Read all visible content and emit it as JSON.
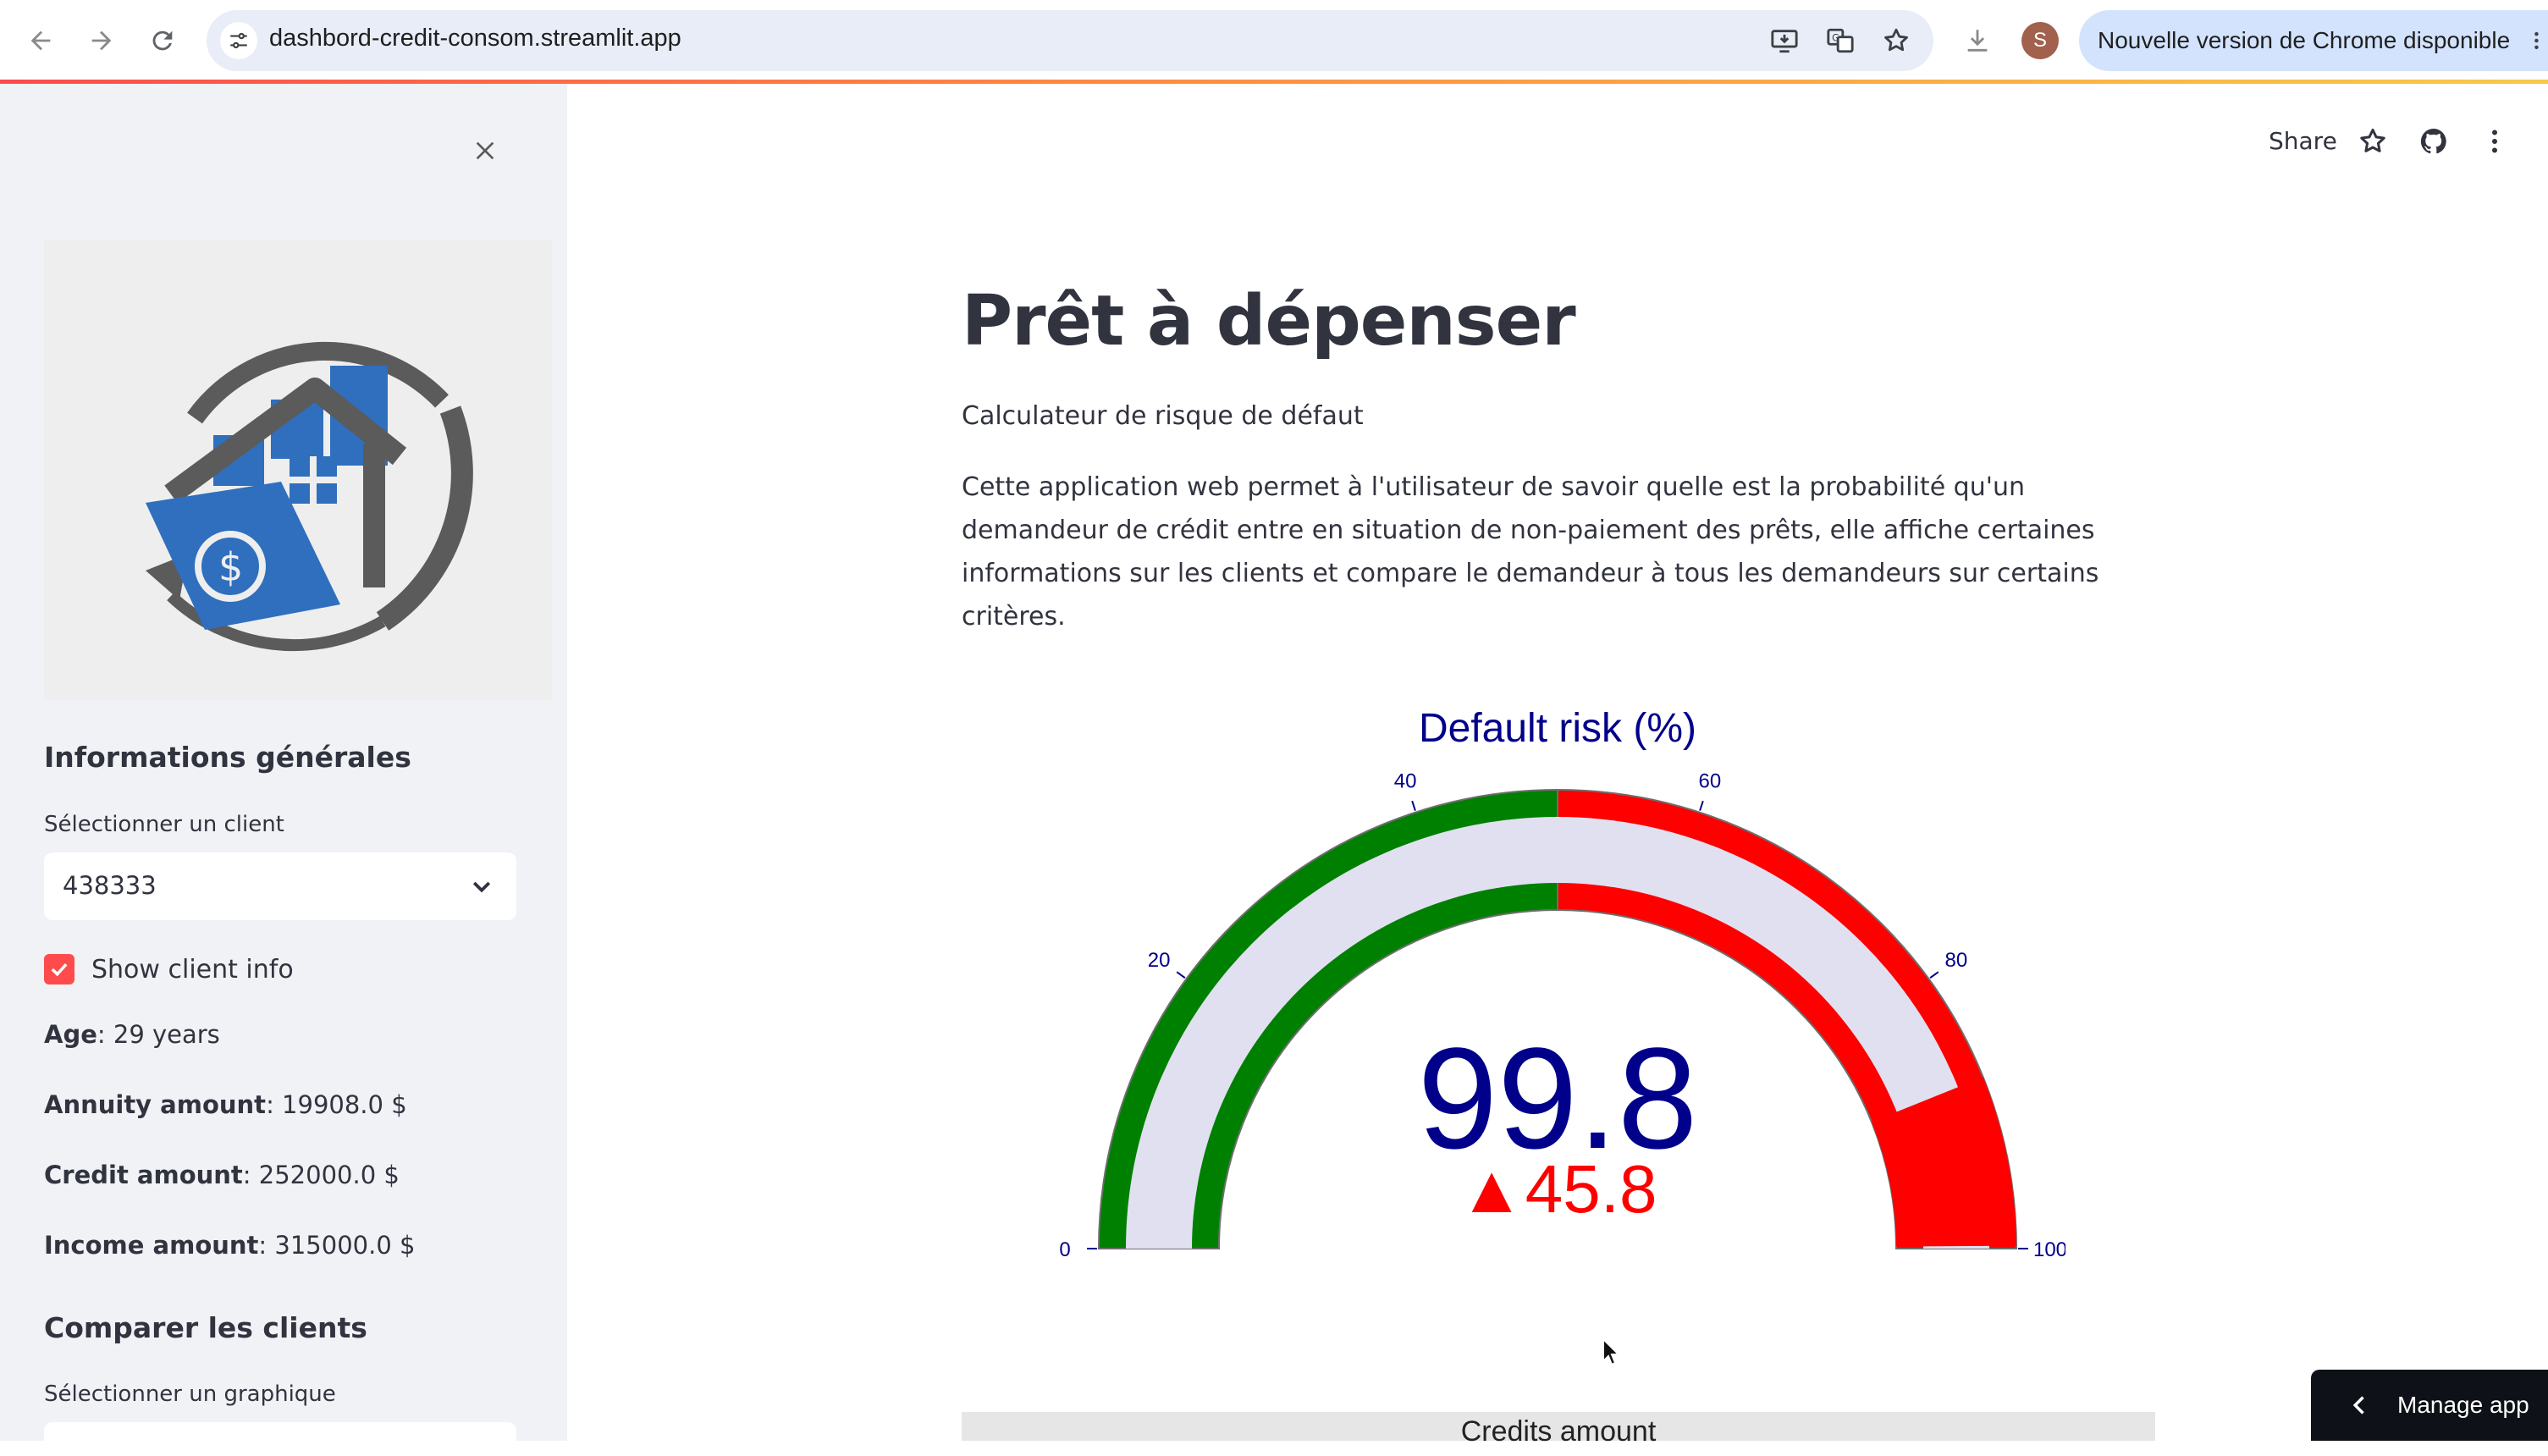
{
  "browser": {
    "url": "dashbord-credit-consom.streamlit.app",
    "profile_initial": "S",
    "update_label": "Nouvelle version de Chrome disponible",
    "icons": [
      "back-icon",
      "forward-icon",
      "reload-icon",
      "site-settings-icon",
      "install-icon",
      "translate-icon",
      "bookmark-star-icon",
      "download-icon",
      "more-vert-icon"
    ]
  },
  "sidebar": {
    "section_general": "Informations générales",
    "select_client_label": "Sélectionner un client",
    "selected_client": "438333",
    "show_client_info_label": "Show client info",
    "show_client_info_checked": true,
    "info": [
      {
        "label": "Age",
        "value": ": 29 years"
      },
      {
        "label": "Annuity amount",
        "value": ": 19908.0 $"
      },
      {
        "label": "Credit amount",
        "value": ": 252000.0 $"
      },
      {
        "label": "Income amount",
        "value": ": 315000.0 $"
      }
    ],
    "section_compare": "Comparer les clients",
    "select_graph_label": "Sélectionner un graphique"
  },
  "header": {
    "share_label": "Share"
  },
  "main": {
    "title": "Prêt à dépenser",
    "subtitle": "Calculateur de risque de défaut",
    "description": "Cette application web permet à l'utilisateur de savoir quelle est la probabilité qu'un demandeur de crédit entre en situation de non-paiement des prêts, elle affiche certaines informations sur les clients et compare le demandeur à tous les demandeurs sur certains critères.",
    "next_chart_title": "Credits amount"
  },
  "chart_data": {
    "type": "gauge",
    "title": "Default risk (%)",
    "value": 99.8,
    "value_label": "99.8",
    "delta": 45.8,
    "delta_label": "▲45.8",
    "range": [
      0,
      100
    ],
    "ticks": [
      0,
      20,
      40,
      60,
      80,
      100
    ],
    "tick_labels": [
      "0",
      "20",
      "40",
      "60",
      "80",
      "100"
    ],
    "steps": [
      {
        "range": [
          0,
          50
        ],
        "color": "#008000"
      },
      {
        "range": [
          50,
          100
        ],
        "color": "#ff0000"
      }
    ],
    "bar_color": "#ff0000",
    "background_color": "#e0e0f0",
    "text_color": "#00008b"
  },
  "manage_app_label": "Manage app"
}
